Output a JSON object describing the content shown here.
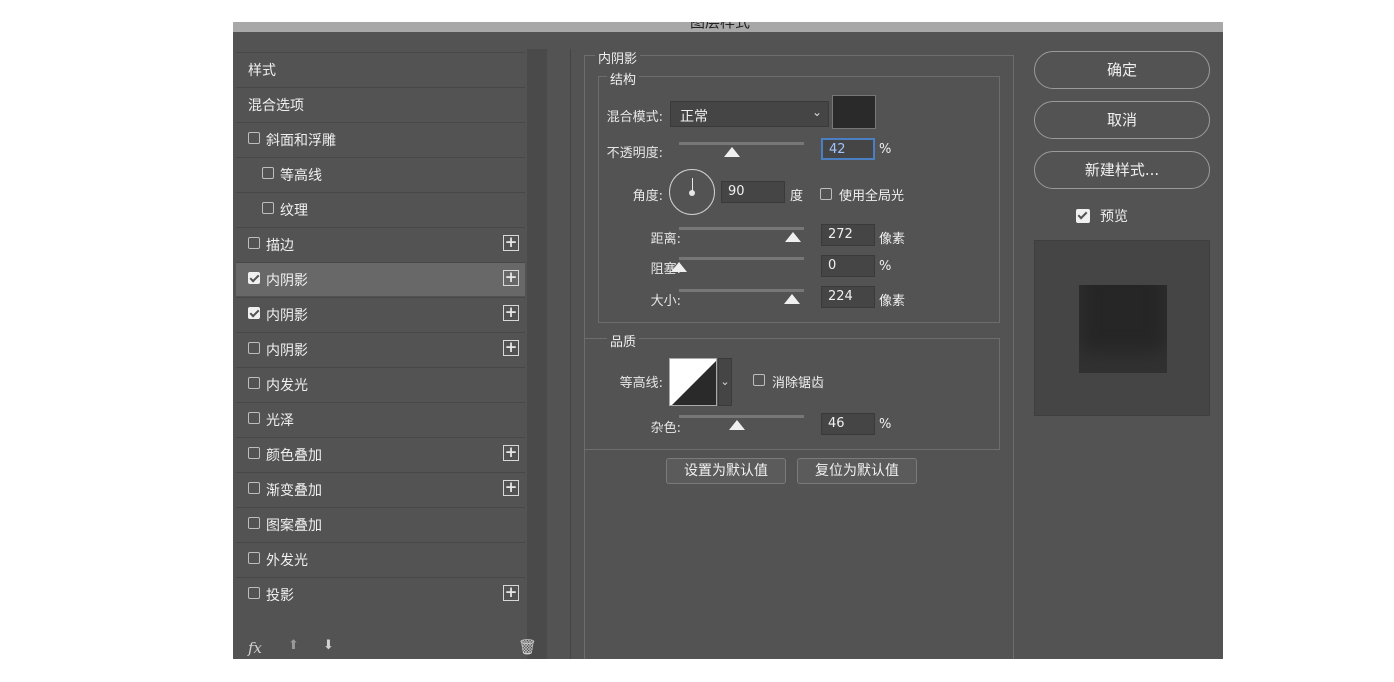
{
  "window": {
    "title": "图层样式"
  },
  "styles_list": {
    "items": [
      {
        "label": "样式",
        "checkbox": null,
        "checked": false,
        "plus": false,
        "selected": false,
        "indent": 0
      },
      {
        "label": "混合选项",
        "checkbox": null,
        "checked": false,
        "plus": false,
        "selected": false,
        "indent": 0
      },
      {
        "label": "斜面和浮雕",
        "checkbox": true,
        "checked": false,
        "plus": false,
        "selected": false,
        "indent": 0
      },
      {
        "label": "等高线",
        "checkbox": true,
        "checked": false,
        "plus": false,
        "selected": false,
        "indent": 1
      },
      {
        "label": "纹理",
        "checkbox": true,
        "checked": false,
        "plus": false,
        "selected": false,
        "indent": 1
      },
      {
        "label": "描边",
        "checkbox": true,
        "checked": false,
        "plus": true,
        "selected": false,
        "indent": 0
      },
      {
        "label": "内阴影",
        "checkbox": true,
        "checked": true,
        "plus": true,
        "selected": true,
        "indent": 0
      },
      {
        "label": "内阴影",
        "checkbox": true,
        "checked": true,
        "plus": true,
        "selected": false,
        "indent": 0
      },
      {
        "label": "内阴影",
        "checkbox": true,
        "checked": false,
        "plus": true,
        "selected": false,
        "indent": 0
      },
      {
        "label": "内发光",
        "checkbox": true,
        "checked": false,
        "plus": false,
        "selected": false,
        "indent": 0
      },
      {
        "label": "光泽",
        "checkbox": true,
        "checked": false,
        "plus": false,
        "selected": false,
        "indent": 0
      },
      {
        "label": "颜色叠加",
        "checkbox": true,
        "checked": false,
        "plus": true,
        "selected": false,
        "indent": 0
      },
      {
        "label": "渐变叠加",
        "checkbox": true,
        "checked": false,
        "plus": true,
        "selected": false,
        "indent": 0
      },
      {
        "label": "图案叠加",
        "checkbox": true,
        "checked": false,
        "plus": false,
        "selected": false,
        "indent": 0
      },
      {
        "label": "外发光",
        "checkbox": true,
        "checked": false,
        "plus": false,
        "selected": false,
        "indent": 0
      },
      {
        "label": "投影",
        "checkbox": true,
        "checked": false,
        "plus": true,
        "selected": false,
        "indent": 0
      }
    ],
    "footer": {
      "fx_label": "fx",
      "up_icon": "arrow-up-icon",
      "down_icon": "arrow-down-icon",
      "trash_icon": "trash-icon"
    }
  },
  "inner_shadow": {
    "section_title": "内阴影",
    "structure": {
      "title": "结构",
      "blend_mode_label": "混合模式:",
      "blend_mode_value": "正常",
      "shadow_color": "#2a2a2a",
      "opacity_label": "不透明度:",
      "opacity_value": "42",
      "opacity_unit": "%",
      "opacity_fraction": 0.42,
      "angle_label": "角度:",
      "angle_value": "90",
      "angle_unit": "度",
      "use_global_light_label": "使用全局光",
      "use_global_light_checked": false,
      "distance_label": "距离:",
      "distance_value": "272",
      "distance_unit": "像素",
      "distance_fraction": 0.91,
      "choke_label": "阻塞:",
      "choke_value": "0",
      "choke_unit": "%",
      "choke_fraction": 0.0,
      "size_label": "大小:",
      "size_value": "224",
      "size_unit": "像素",
      "size_fraction": 0.9
    },
    "quality": {
      "title": "品质",
      "contour_label": "等高线:",
      "anti_alias_label": "消除锯齿",
      "anti_alias_checked": false,
      "noise_label": "杂色:",
      "noise_value": "46",
      "noise_unit": "%",
      "noise_fraction": 0.46
    },
    "set_default_label": "设置为默认值",
    "reset_default_label": "复位为默认值"
  },
  "right_panel": {
    "ok_label": "确定",
    "cancel_label": "取消",
    "new_style_label": "新建样式...",
    "preview_label": "预览",
    "preview_checked": true
  }
}
